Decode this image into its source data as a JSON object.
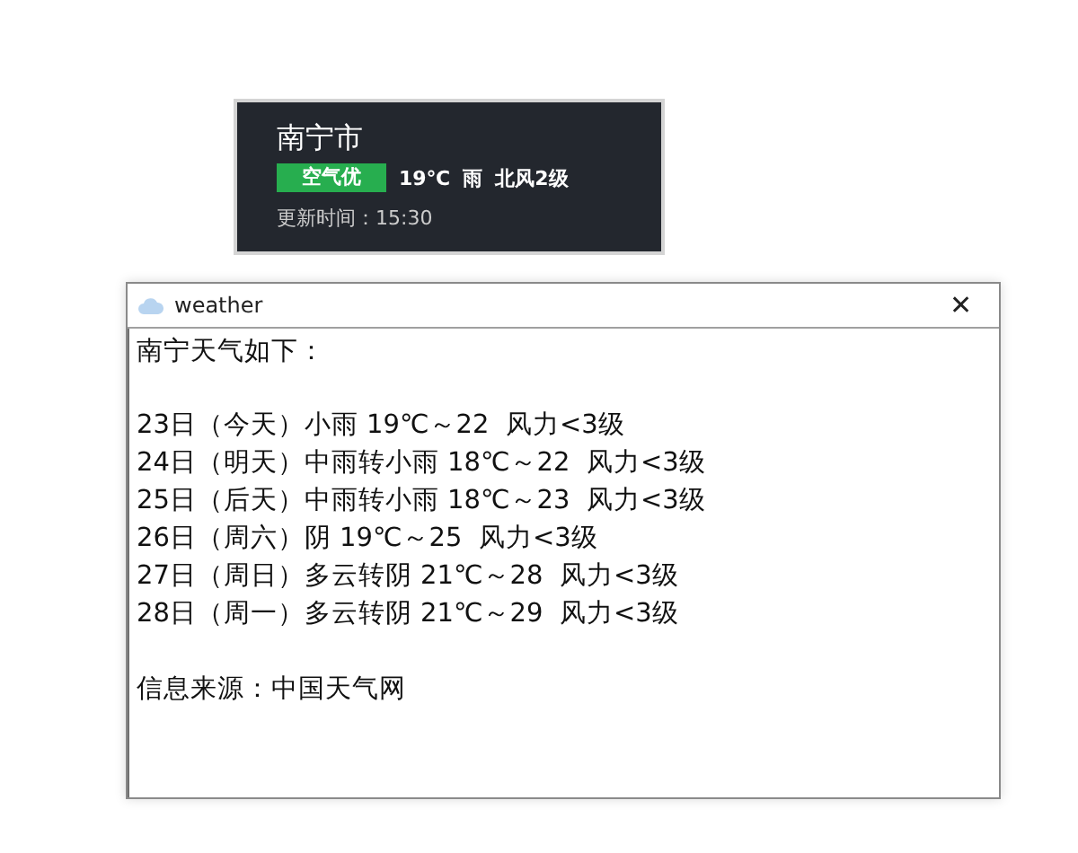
{
  "widget": {
    "city": "南宁市",
    "air_quality": "空气优",
    "temperature": "19℃",
    "condition": "雨",
    "wind": "北风2级",
    "updated": "更新时间：15:30"
  },
  "window": {
    "title": "weather",
    "close": "✕"
  },
  "report": {
    "heading": "南宁天气如下：",
    "lines": [
      "23日（今天）小雨 19℃～22  风力<3级",
      "24日（明天）中雨转小雨 18℃～22  风力<3级",
      "25日（后天）中雨转小雨 18℃～23  风力<3级",
      "26日（周六）阴 19℃～25  风力<3级",
      "27日（周日）多云转阴 21℃～28  风力<3级",
      "28日（周一）多云转阴 21℃～29  风力<3级"
    ],
    "source": "信息来源：中国天气网"
  }
}
